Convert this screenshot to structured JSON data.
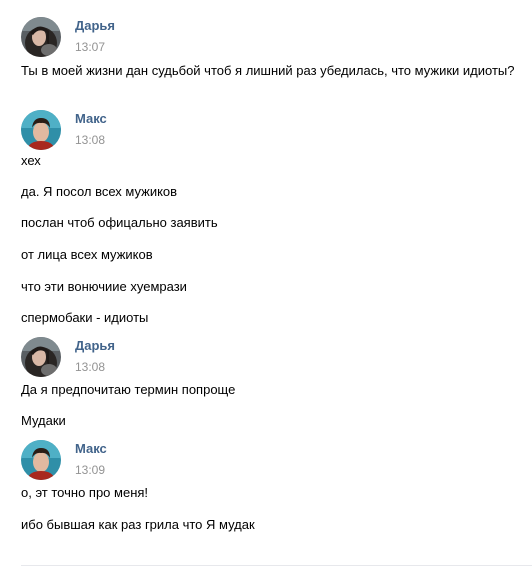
{
  "colors": {
    "author": "#42648b",
    "time": "#939393",
    "text": "#000000",
    "divider": "#e7e8ec"
  },
  "messages": [
    {
      "author": "Дарья",
      "time": "13:07",
      "avatar": "avatar-darya",
      "lines": [
        "Ты в моей жизни дан судьбой чтоб я лишний раз убедилась, что мужики идиоты?"
      ]
    },
    {
      "author": "Макс",
      "time": "13:08",
      "avatar": "avatar-maks",
      "lines": [
        "хех",
        "да. Я посол всех мужиков",
        "послан чтоб офицально заявить",
        "от лица всех мужиков",
        "что эти вонючиие хуемрази",
        "спермобаки - идиоты"
      ]
    },
    {
      "author": "Дарья",
      "time": "13:08",
      "avatar": "avatar-darya",
      "lines": [
        "Да я предпочитаю термин попроще",
        "Мудаки"
      ]
    },
    {
      "author": "Макс",
      "time": "13:09",
      "avatar": "avatar-maks",
      "lines": [
        "о, эт точно про меня!",
        "ибо бывшая как раз грила что Я мудак"
      ]
    }
  ]
}
